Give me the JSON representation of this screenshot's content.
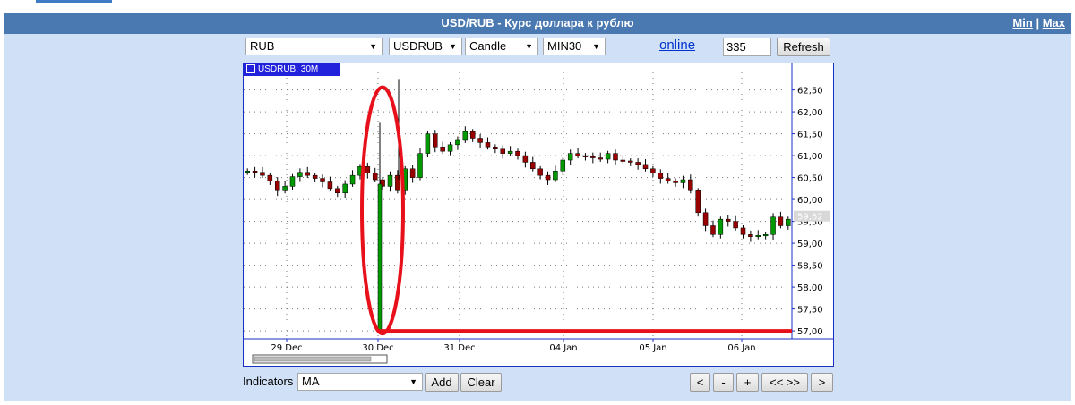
{
  "header": {
    "title": "USD/RUB - Курс доллара к рублю",
    "min_label": "Min",
    "separator": "|",
    "max_label": "Max"
  },
  "controls": {
    "currency": "RUB",
    "pair": "USDRUB",
    "chart_type": "Candle",
    "interval": "MIN30",
    "online_label": "online",
    "count_value": "335",
    "refresh_label": "Refresh"
  },
  "chart_tab_label": "USDRUB: 30M",
  "footer": {
    "indicators_label": "Indicators",
    "indicator_value": "MA",
    "add_label": "Add",
    "clear_label": "Clear",
    "nav": [
      "<",
      "-",
      "+",
      "<< >>",
      ">"
    ]
  },
  "colors": {
    "up": "#009900",
    "down": "#990000",
    "annotation": "#e8101a",
    "frame": "#1a2fc8"
  },
  "chart_data": {
    "type": "candlestick",
    "symbol": "USDRUB",
    "timeframe": "30M",
    "x_ticks": [
      "29 Dec",
      "30 Dec",
      "31 Dec",
      "04 Jan",
      "05 Jan",
      "06 Jan"
    ],
    "y_ticks": [
      "62,50",
      "62,00",
      "61,50",
      "61,00",
      "60,50",
      "60,00",
      "59,50",
      "59,00",
      "58,50",
      "58,00",
      "57,50",
      "57,00"
    ],
    "ylim": [
      56.9,
      62.9
    ],
    "last_price_label": "59,62",
    "grid": true,
    "close_series": [
      60.65,
      60.62,
      60.55,
      60.42,
      60.2,
      60.3,
      60.52,
      60.62,
      60.55,
      60.48,
      60.4,
      60.25,
      60.15,
      60.35,
      60.55,
      60.75,
      60.6,
      60.45,
      60.3,
      60.55,
      60.2,
      60.7,
      60.5,
      61.05,
      61.5,
      61.2,
      61.1,
      61.25,
      61.35,
      61.55,
      61.4,
      61.3,
      61.2,
      61.15,
      61.05,
      61.1,
      61.0,
      60.85,
      60.7,
      60.55,
      60.45,
      60.65,
      60.9,
      61.05,
      61.0,
      60.98,
      60.95,
      60.92,
      61.05,
      60.9,
      60.88,
      60.85,
      60.8,
      60.7,
      60.6,
      60.48,
      60.42,
      60.38,
      60.45,
      60.2,
      59.7,
      59.4,
      59.2,
      59.55,
      59.5,
      59.35,
      59.2,
      59.15,
      59.18,
      59.2,
      59.6,
      59.4,
      59.55
    ],
    "annotations": {
      "ellipse": "highlight around 30 Dec price spike",
      "horizontal_line_value": 57.0
    }
  }
}
